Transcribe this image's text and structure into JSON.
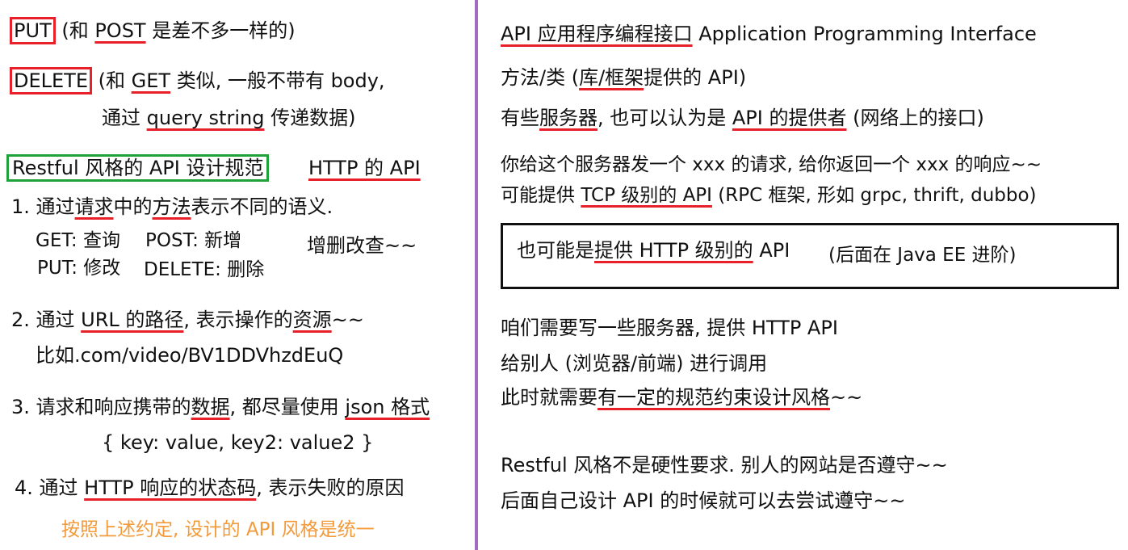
{
  "colors": {
    "accent_red": "#e8202a",
    "accent_green": "#1fa23a",
    "accent_orange": "#f39a3a",
    "divider": "#a46bc0"
  },
  "left": {
    "put": {
      "label": "PUT",
      "text1": " (和 ",
      "post": "POST",
      "text2": " 是差不多一样的)"
    },
    "delete": {
      "label": "DELETE",
      "text1": " (和 ",
      "get": "GET",
      "text2": " 类似, 一般不带有 body,"
    },
    "delete_line2": {
      "text1": "通过 ",
      "qs": "query string",
      "text2": " 传递数据)"
    },
    "restful": {
      "title": "Restful 风格的 API 设计规范",
      "http_api": "HTTP 的 API"
    },
    "item1": {
      "prefix": "1. 通过",
      "req": "请求",
      "mid": "中的",
      "method": "方法",
      "suffix": "表示不同的语义."
    },
    "crud": {
      "get": "GET: 查询",
      "post": "POST: 新增",
      "put": "PUT: 修改",
      "delete": "DELETE: 删除",
      "note": "增删改查~~"
    },
    "item2": {
      "prefix": "2. 通过 ",
      "url": "URL 的路径",
      "mid": ", 表示操作的",
      "res": "资源",
      "suffix": "~~"
    },
    "item2_example": "比如.com/video/BV1DDVhzdEuQ",
    "item3": {
      "prefix": "3. 请求和响应携带的",
      "data": "数据",
      "mid": ", 都尽量使用 ",
      "json": "json 格式"
    },
    "item3_example": "{  key: value,   key2: value2  }",
    "item4": {
      "prefix": "4. 通过 ",
      "status": "HTTP 响应的状态码",
      "suffix": ", 表示失败的原因"
    },
    "conclusion": "按照上述约定, 设计的 API 风格是统一"
  },
  "right": {
    "api_def": {
      "cn": "API 应用程序编程接口",
      "en": "   Application Programming Interface"
    },
    "line2": {
      "prefix": "方法/类 (",
      "lib": "库/框架",
      "suffix": "提供的 API)"
    },
    "line3": {
      "prefix": "有些",
      "server": "服务器",
      "mid": ", 也可以认为是 ",
      "provider": "API 的提供者",
      "suffix": " (网络上的接口)"
    },
    "line4": "你给这个服务器发一个 xxx 的请求, 给你返回一个 xxx 的响应~~",
    "line5": {
      "prefix": "可能提供 ",
      "tcp": "TCP 级别的 API",
      "suffix": " (RPC 框架, 形如 grpc, thrift, dubbo)"
    },
    "box": {
      "prefix": "也可能是",
      "http": "提供 HTTP 级别的",
      "suffix": " API",
      "note": "(后面在 Java EE 进阶)"
    },
    "line6": "咱们需要写一些服务器, 提供 HTTP API",
    "line7": "给别人 (浏览器/前端) 进行调用",
    "line8": {
      "prefix": "此时就需要",
      "norm": "有一定的规范约束设计风格",
      "suffix": "~~"
    },
    "line9": "Restful 风格不是硬性要求. 别人的网站是否遵守~~",
    "line10": "后面自己设计 API 的时候就可以去尝试遵守~~"
  }
}
